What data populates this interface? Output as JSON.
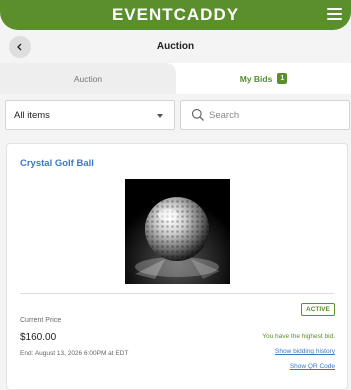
{
  "header": {
    "logo": "EVENTCADDY"
  },
  "titlebar": {
    "title": "Auction"
  },
  "tabs": [
    {
      "label": "Auction"
    },
    {
      "label": "My Bids",
      "badge": "1"
    }
  ],
  "filters": {
    "category": "All items",
    "search_placeholder": "Search"
  },
  "item": {
    "title": "Crystal Golf Ball",
    "status": "ACTIVE",
    "price_label": "Current Price",
    "price": "$160.00",
    "end": "End: August 13, 2026 6:00PM at EDT",
    "bid_status": "You have the highest bid.",
    "history_link": "Show bidding history",
    "qr_link": "Show QR Code"
  },
  "colors": {
    "brand_green": "#5a8f2b",
    "link_blue": "#3b78c3"
  }
}
